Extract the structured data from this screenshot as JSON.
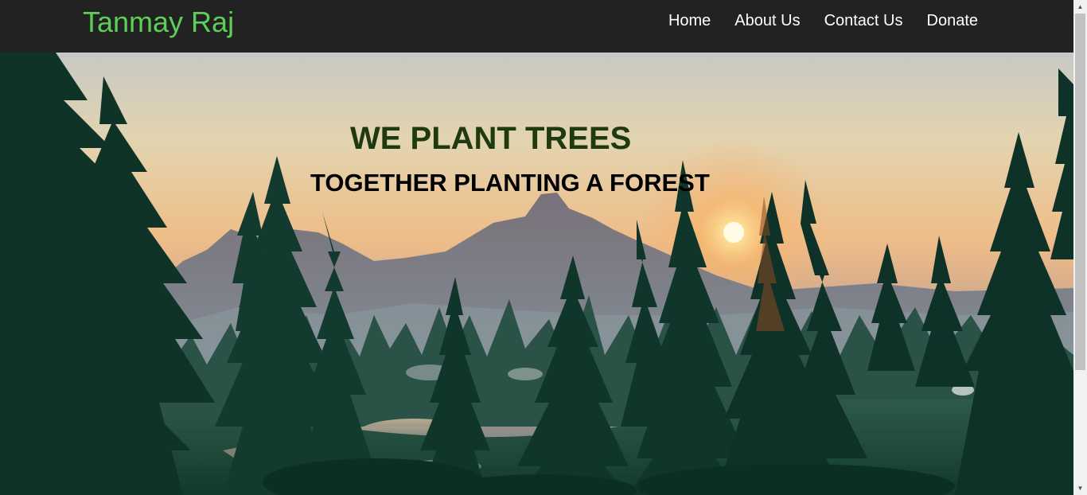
{
  "nav": {
    "brand": "Tanmay Raj",
    "links": [
      "Home",
      "About Us",
      "Contact Us",
      "Donate"
    ]
  },
  "hero": {
    "title": "WE PLANT TREES",
    "subtitle": "TOGETHER PLANTING A FOREST"
  },
  "colors": {
    "navbar_bg": "#222222",
    "brand": "#5ccf57",
    "nav_link": "#ffffff",
    "hero_title": "#1f3a0f",
    "hero_subtitle": "#000000",
    "sky_top": "#c9c9c6",
    "sky_glow": "#f2b27a",
    "forest_dark": "#0f3327"
  },
  "icons": {
    "scroll_up": "triangle-up-icon",
    "scroll_down": "triangle-down-icon"
  }
}
